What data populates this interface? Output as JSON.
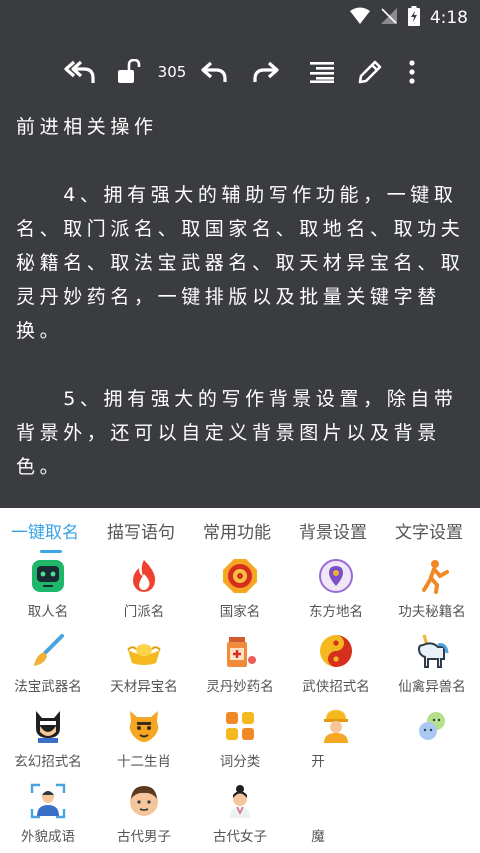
{
  "status": {
    "time": "4:18"
  },
  "toolbar": {
    "count": "305"
  },
  "editor": {
    "paragraphs": [
      "前进相关操作",
      "",
      "　　4、拥有强大的辅助写作功能，一键取名、取门派名、取国家名、取地名、取功夫秘籍名、取法宝武器名、取天材异宝名、取灵丹妙药名，一键排版以及批量关键字替换。",
      "",
      "　　5、拥有强大的写作背景设置，除自带背景外，还可以自定义背景图片以及背景色。"
    ]
  },
  "tabs": [
    {
      "label": "一键取名",
      "active": true
    },
    {
      "label": "描写语句"
    },
    {
      "label": "常用功能"
    },
    {
      "label": "背景设置"
    },
    {
      "label": "文字设置"
    }
  ],
  "items": [
    {
      "label": "取人名",
      "icon": "robot-face-icon"
    },
    {
      "label": "门派名",
      "icon": "flame-icon"
    },
    {
      "label": "国家名",
      "icon": "medallion-icon"
    },
    {
      "label": "东方地名",
      "icon": "location-pin-icon"
    },
    {
      "label": "功夫秘籍名",
      "icon": "martial-artist-icon"
    },
    {
      "label": "法宝武器名",
      "icon": "brush-icon"
    },
    {
      "label": "天材异宝名",
      "icon": "gold-ingot-icon"
    },
    {
      "label": "灵丹妙药名",
      "icon": "medicine-bottle-icon"
    },
    {
      "label": "武侠招式名",
      "icon": "yin-yang-icon"
    },
    {
      "label": "仙禽异兽名",
      "icon": "unicorn-icon"
    },
    {
      "label": "玄幻招式名",
      "icon": "masked-hero-icon"
    },
    {
      "label": "十二生肖",
      "icon": "tiger-icon"
    },
    {
      "label": "词分类",
      "icon": "categories-icon"
    },
    {
      "label": "开",
      "icon": "worker-icon"
    },
    {
      "label": "",
      "icon": "balls-icon"
    },
    {
      "label": "外貌成语",
      "icon": "face-scan-icon"
    },
    {
      "label": "古代男子",
      "icon": "man-face-icon"
    },
    {
      "label": "古代女子",
      "icon": "woman-face-icon"
    },
    {
      "label": "魔",
      "icon": ""
    }
  ]
}
